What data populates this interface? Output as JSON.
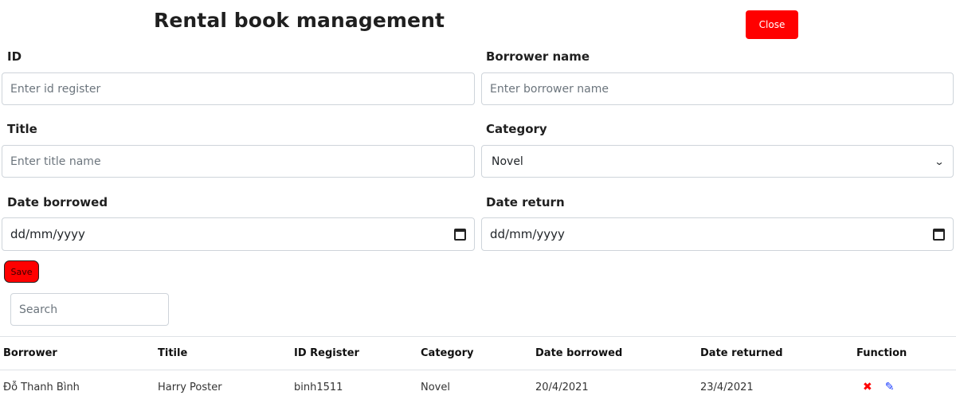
{
  "header": {
    "title": "Rental book management",
    "close_label": "Close"
  },
  "form": {
    "id": {
      "label": "ID",
      "placeholder": "Enter id register"
    },
    "borrower": {
      "label": "Borrower name",
      "placeholder": "Enter borrower name"
    },
    "title": {
      "label": "Title",
      "placeholder": "Enter title name"
    },
    "category": {
      "label": "Category",
      "selected": "Novel"
    },
    "date_borrowed": {
      "label": "Date borrowed",
      "value": "dd/mm/yyyy"
    },
    "date_return": {
      "label": "Date return",
      "value": "dd/mm/yyyy"
    },
    "save_label": "Save"
  },
  "search": {
    "placeholder": "Search"
  },
  "table": {
    "columns": [
      "Borrower",
      "Titile",
      "ID Register",
      "Category",
      "Date borrowed",
      "Date returned",
      "Function"
    ],
    "rows": [
      {
        "borrower": "Đỗ Thanh Bình",
        "title": "Harry Poster",
        "id_register": "binh1511",
        "category": "Novel",
        "date_borrowed": "20/4/2021",
        "date_returned": "23/4/2021"
      }
    ]
  },
  "icons": {
    "delete": "✖",
    "edit": "✎",
    "chevron": "⌄"
  },
  "colors": {
    "accent_red": "#ff0000",
    "edit_blue": "#1a3cff"
  }
}
